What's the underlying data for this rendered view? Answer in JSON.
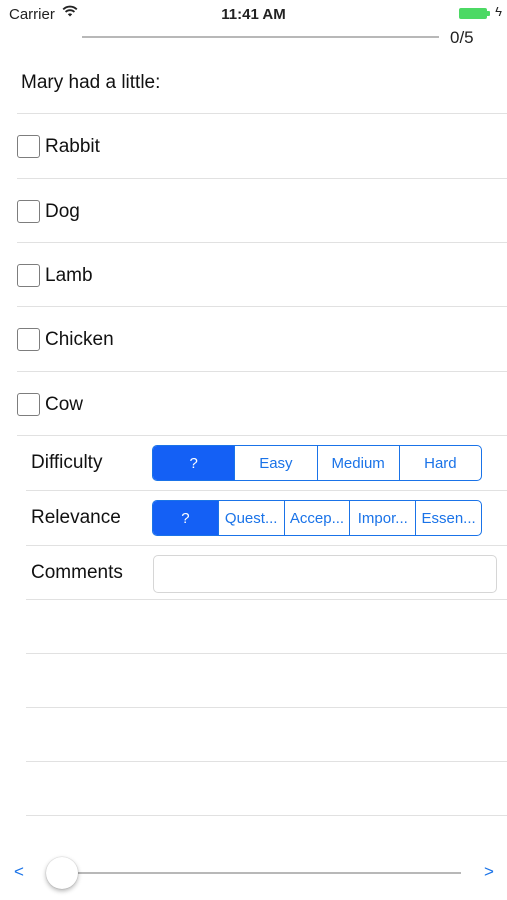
{
  "status_bar": {
    "carrier": "Carrier",
    "time": "11:41 AM"
  },
  "progress": {
    "text": "0/5",
    "fraction": 0.0
  },
  "question": {
    "text": "Mary had a little:",
    "options": [
      {
        "label": "Rabbit",
        "checked": false
      },
      {
        "label": "Dog",
        "checked": false
      },
      {
        "label": "Lamb",
        "checked": false
      },
      {
        "label": "Chicken",
        "checked": false
      },
      {
        "label": "Cow",
        "checked": false
      }
    ]
  },
  "difficulty": {
    "label": "Difficulty",
    "segments": [
      "?",
      "Easy",
      "Medium",
      "Hard"
    ],
    "selected": "?"
  },
  "relevance": {
    "label": "Relevance",
    "segments": [
      "?",
      "Quest...",
      "Accep...",
      "Impor...",
      "Essen..."
    ],
    "selected": "?"
  },
  "comments": {
    "label": "Comments",
    "value": ""
  },
  "navigation": {
    "prev": "<",
    "next": ">",
    "slider_fraction": 0.0
  },
  "colors": {
    "accent": "#1a73e8",
    "selected_segment": "#1460f5",
    "battery": "#4cd964"
  }
}
